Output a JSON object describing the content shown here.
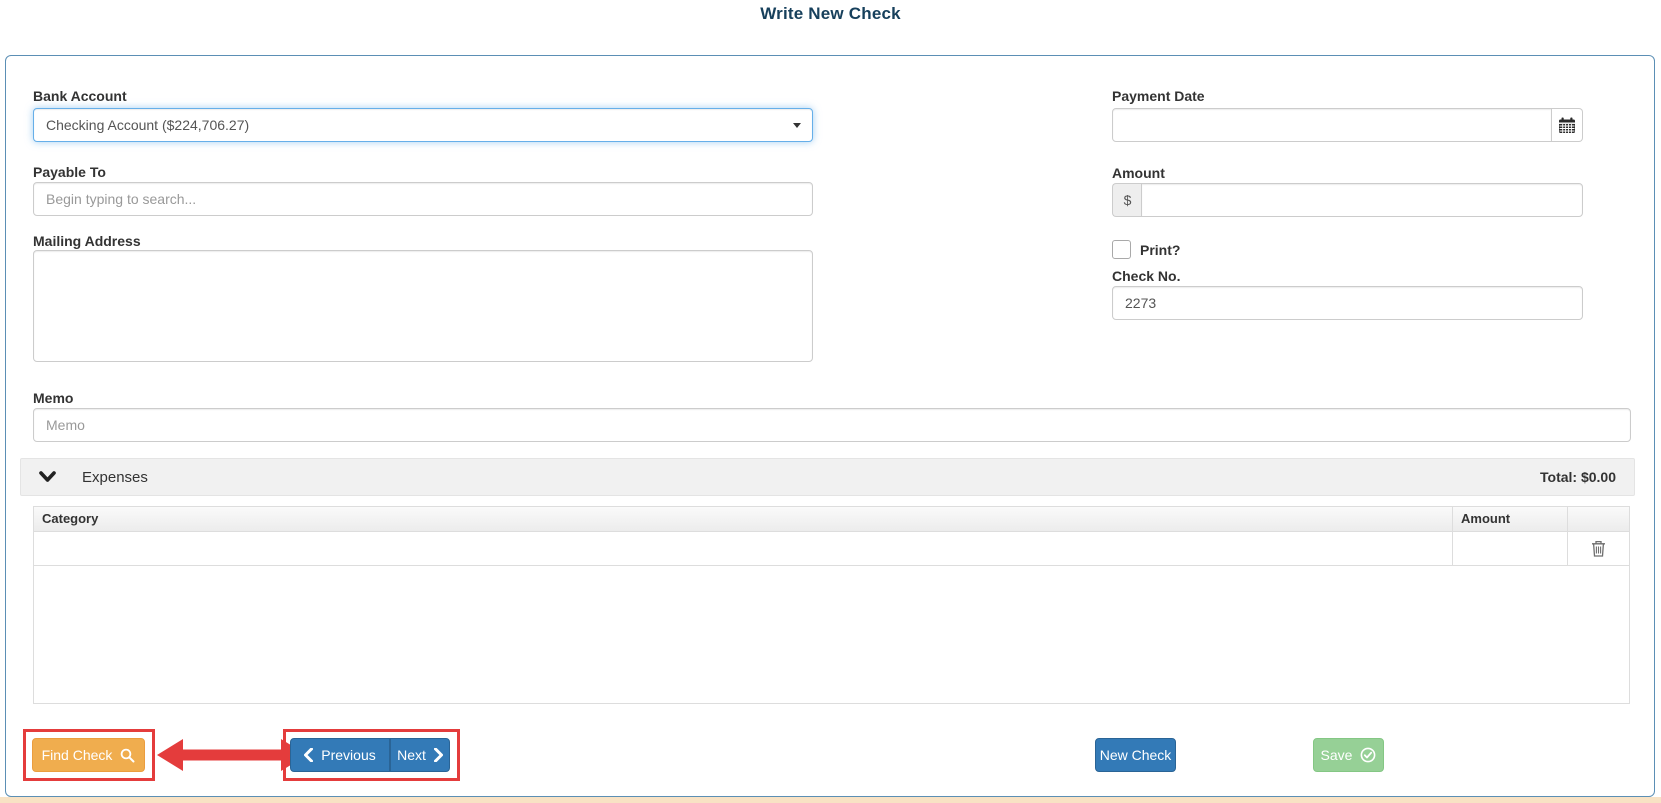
{
  "page_title": "Write New Check",
  "form": {
    "bank_account": {
      "label": "Bank Account",
      "value": "Checking Account ($224,706.27)"
    },
    "payment_date": {
      "label": "Payment Date",
      "value": ""
    },
    "payable_to": {
      "label": "Payable To",
      "placeholder": "Begin typing to search..."
    },
    "amount": {
      "label": "Amount",
      "prefix": "$",
      "value": ""
    },
    "print": {
      "label": "Print?"
    },
    "check_no": {
      "label": "Check No.",
      "value": "2273"
    },
    "mailing_address": {
      "label": "Mailing Address",
      "value": ""
    },
    "memo": {
      "label": "Memo",
      "placeholder": "Memo",
      "value": ""
    }
  },
  "expenses": {
    "title": "Expenses",
    "total_label": "Total: $0.00",
    "table": {
      "headers": [
        "Category",
        "Amount",
        ""
      ],
      "rows": [
        {
          "category": "",
          "amount": ""
        }
      ]
    }
  },
  "buttons": {
    "find_check": "Find Check",
    "previous": "Previous",
    "next": "Next",
    "new_check": "New Check",
    "save": "Save"
  },
  "icons": {
    "select_caret": "caret-down",
    "calendar": "calendar-grid",
    "search": "magnifier",
    "chevron_down": "chevron-down",
    "chevron_left": "chevron-left",
    "chevron_right": "chevron-right",
    "trash": "trash-can",
    "save_check": "check-circle",
    "annotation_arrow": "double-headed-arrow"
  },
  "colors": {
    "title": "#17405c",
    "panel-border": "#5b8fb5",
    "primary": "#337ab7",
    "primary-border": "#2a6496",
    "warning": "#f0ad4e",
    "warning-border": "#eb9d3e",
    "success": "#96d096",
    "success-border": "#84c784",
    "annotation": "#e43c3c",
    "strip": "#f8e2c4"
  }
}
